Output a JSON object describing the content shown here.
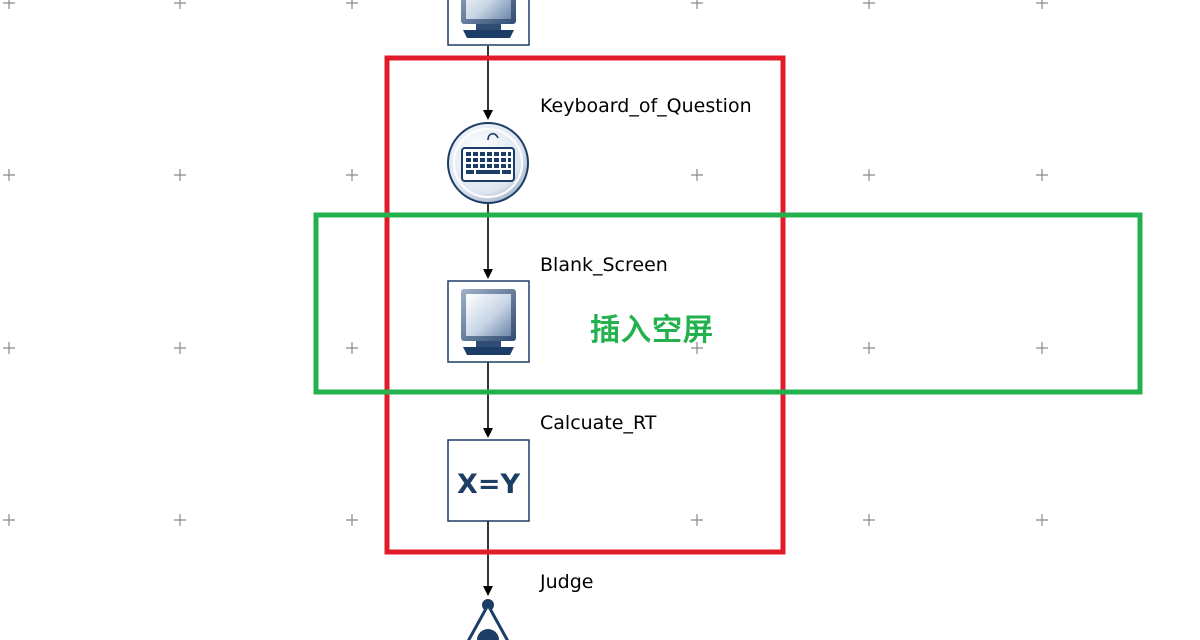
{
  "colors": {
    "background": "#ffffff",
    "grid_cross": "#8a8a8a",
    "connector": "#000000",
    "node_border": "#1c3d66",
    "node_fill": "#ffffff",
    "icon_navy": "#1c3d66",
    "highlight_red": "#e21b2b",
    "highlight_green": "#22b14c"
  },
  "nodes": [
    {
      "id": "prev-display",
      "type": "display",
      "label": ""
    },
    {
      "id": "keyboard",
      "type": "input",
      "label": "Keyboard_of_Question"
    },
    {
      "id": "blank-screen",
      "type": "display",
      "label": "Blank_Screen"
    },
    {
      "id": "calculate",
      "type": "calculation",
      "label": "Calcuate_RT",
      "icon_text": "X=Y"
    },
    {
      "id": "judge",
      "type": "condition",
      "label": "Judge"
    }
  ],
  "annotation": {
    "text": "插入空屏"
  }
}
